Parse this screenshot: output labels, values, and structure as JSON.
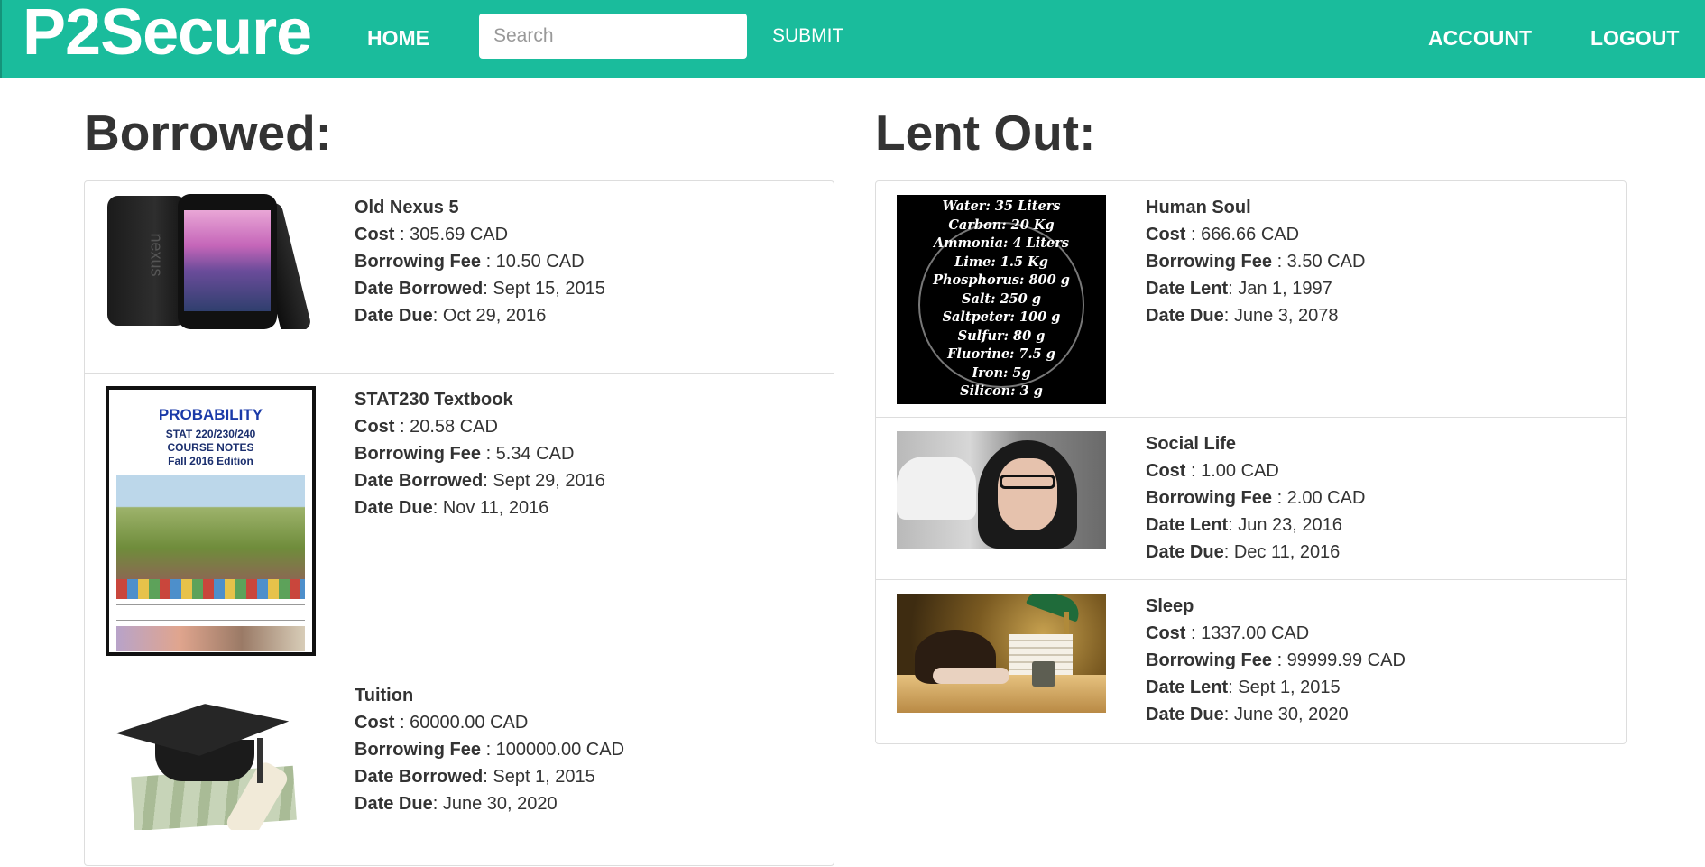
{
  "brand": "P2Secure",
  "nav": {
    "home": "HOME",
    "search_placeholder": "Search",
    "submit": "SUBMIT",
    "account": "ACCOUNT",
    "logout": "LOGOUT"
  },
  "borrowed": {
    "heading": "Borrowed:",
    "items": [
      {
        "name": "Old Nexus 5",
        "cost_label": "Cost",
        "cost": " : 305.69 CAD",
        "fee_label": "Borrowing Fee",
        "fee": " : 10.50 CAD",
        "date_label": "Date Borrowed",
        "date": ": Sept 15, 2015",
        "due_label": "Date Due",
        "due": ": Oct 29, 2016",
        "image": "phone-image"
      },
      {
        "name": "STAT230 Textbook",
        "cost_label": "Cost",
        "cost": " : 20.58 CAD",
        "fee_label": "Borrowing Fee",
        "fee": " : 5.34 CAD",
        "date_label": "Date Borrowed",
        "date": ": Sept 29, 2016",
        "due_label": "Date Due",
        "due": ": Nov 11, 2016",
        "image": "textbook-cover-image",
        "cover_title": "PROBABILITY",
        "cover_line1": "STAT 220/230/240",
        "cover_line2": "COURSE NOTES",
        "cover_line3": "Fall 2016 Edition"
      },
      {
        "name": "Tuition",
        "cost_label": "Cost",
        "cost": " : 60000.00 CAD",
        "fee_label": "Borrowing Fee",
        "fee": " : 100000.00 CAD",
        "date_label": "Date Borrowed",
        "date": ": Sept 1, 2015",
        "due_label": "Date Due",
        "due": ": June 30, 2020",
        "image": "graduation-cap-image"
      }
    ]
  },
  "lent": {
    "heading": "Lent Out:",
    "items": [
      {
        "name": "Human Soul",
        "cost_label": "Cost",
        "cost": " : 666.66 CAD",
        "fee_label": "Borrowing Fee",
        "fee": " : 3.50 CAD",
        "date_label": "Date Lent",
        "date": ": Jan 1, 1997",
        "due_label": "Date Due",
        "due": ": June 3, 2078",
        "image": "soul-ingredients-image",
        "soul_lines": [
          "Water: 35 Liters",
          "Carbon: 20 Kg",
          "Ammonia: 4 Liters",
          "Lime: 1.5 Kg",
          "Phosphorus: 800 g",
          "Salt: 250 g",
          "Saltpeter: 100 g",
          "Sulfur: 80 g",
          "Fluorine: 7.5 g",
          "Iron: 5g",
          "Silicon: 3 g"
        ]
      },
      {
        "name": "Social Life",
        "cost_label": "Cost",
        "cost": " : 1.00 CAD",
        "fee_label": "Borrowing Fee",
        "fee": " : 2.00 CAD",
        "date_label": "Date Lent",
        "date": ": Jun 23, 2016",
        "due_label": "Date Due",
        "due": ": Dec 11, 2016",
        "image": "hooded-person-photo"
      },
      {
        "name": "Sleep",
        "cost_label": "Cost",
        "cost": " : 1337.00 CAD",
        "fee_label": "Borrowing Fee",
        "fee": " : 99999.99 CAD",
        "date_label": "Date Lent",
        "date": ": Sept 1, 2015",
        "due_label": "Date Due",
        "due": ": June 30, 2020",
        "image": "sleeping-at-desk-photo"
      }
    ]
  },
  "colors": {
    "navbar": "#1abc9c",
    "text": "#333333",
    "border": "#dddddd"
  }
}
